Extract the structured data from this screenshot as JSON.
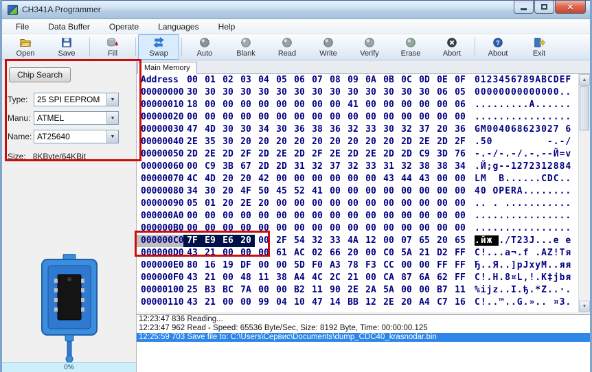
{
  "window": {
    "title": "CH341A Programmer"
  },
  "menu": {
    "items": [
      "File",
      "Data Buffer",
      "Operate",
      "Languages",
      "Help"
    ]
  },
  "toolbar": {
    "buttons": [
      {
        "label": "Open",
        "icon": "open-folder-icon"
      },
      {
        "label": "Save",
        "icon": "save-floppy-icon"
      },
      {
        "label": "Fill",
        "icon": "fill-bucket-icon"
      },
      {
        "label": "Swap",
        "icon": "swap-arrows-icon",
        "active": true
      },
      {
        "label": "Auto",
        "icon": "auto-orb-icon"
      },
      {
        "label": "Blank",
        "icon": "blank-orb-icon"
      },
      {
        "label": "Read",
        "icon": "read-orb-icon"
      },
      {
        "label": "Write",
        "icon": "write-orb-icon"
      },
      {
        "label": "Verify",
        "icon": "verify-orb-icon"
      },
      {
        "label": "Erase",
        "icon": "erase-orb-icon"
      },
      {
        "label": "Abort",
        "icon": "abort-icon"
      },
      {
        "label": "About",
        "icon": "about-icon"
      },
      {
        "label": "Exit",
        "icon": "exit-door-icon"
      }
    ]
  },
  "chip_panel": {
    "search_button": "Chip Search",
    "type_label": "Type:",
    "type_value": "25 SPI EEPROM",
    "manu_label": "Manu:",
    "manu_value": "ATMEL",
    "name_label": "Name:",
    "name_value": "AT25640",
    "size_label": "Size:",
    "size_value": "8KByte/64KBit",
    "progress": "0%"
  },
  "memory": {
    "tab": "Main Memory",
    "header": {
      "address": "Address",
      "bytes": [
        "00",
        "01",
        "02",
        "03",
        "04",
        "05",
        "06",
        "07",
        "08",
        "09",
        "0A",
        "0B",
        "0C",
        "0D",
        "0E",
        "0F"
      ],
      "ascii": "0123456789ABCDEF"
    },
    "selection": {
      "row_address": "000000C0",
      "byte_count": 4,
      "ascii_count": 4
    },
    "rows": [
      {
        "address": "00000000",
        "bytes": [
          "30",
          "30",
          "30",
          "30",
          "30",
          "30",
          "30",
          "30",
          "30",
          "30",
          "30",
          "30",
          "30",
          "30",
          "06",
          "05"
        ],
        "ascii": "00000000000000.."
      },
      {
        "address": "00000010",
        "bytes": [
          "18",
          "00",
          "00",
          "00",
          "00",
          "00",
          "00",
          "00",
          "00",
          "41",
          "00",
          "00",
          "00",
          "00",
          "00",
          "06"
        ],
        "ascii": ".........A......"
      },
      {
        "address": "00000020",
        "bytes": [
          "00",
          "00",
          "00",
          "00",
          "00",
          "00",
          "00",
          "00",
          "00",
          "00",
          "00",
          "00",
          "00",
          "00",
          "00",
          "00"
        ],
        "ascii": "................"
      },
      {
        "address": "00000030",
        "bytes": [
          "47",
          "4D",
          "30",
          "30",
          "34",
          "30",
          "36",
          "38",
          "36",
          "32",
          "33",
          "30",
          "32",
          "37",
          "20",
          "36"
        ],
        "ascii": "GM004068623027 6"
      },
      {
        "address": "00000040",
        "bytes": [
          "2E",
          "35",
          "30",
          "20",
          "20",
          "20",
          "20",
          "20",
          "20",
          "20",
          "20",
          "20",
          "2D",
          "2E",
          "2D",
          "2F"
        ],
        "ascii": ".50         -.-/"
      },
      {
        "address": "00000050",
        "bytes": [
          "2D",
          "2E",
          "2D",
          "2F",
          "2D",
          "2E",
          "2D",
          "2F",
          "2E",
          "2D",
          "2E",
          "2D",
          "2D",
          "C9",
          "3D",
          "76"
        ],
        "ascii": "-.-/-.-/.-.--Й=v"
      },
      {
        "address": "00000060",
        "bytes": [
          "00",
          "C9",
          "3B",
          "67",
          "2D",
          "2D",
          "31",
          "32",
          "37",
          "32",
          "33",
          "31",
          "32",
          "38",
          "38",
          "34"
        ],
        "ascii": ".Й;g--1272312884"
      },
      {
        "address": "00000070",
        "bytes": [
          "4C",
          "4D",
          "20",
          "20",
          "42",
          "00",
          "00",
          "00",
          "00",
          "00",
          "00",
          "43",
          "44",
          "43",
          "00",
          "00"
        ],
        "ascii": "LM  B......CDC.."
      },
      {
        "address": "00000080",
        "bytes": [
          "34",
          "30",
          "20",
          "4F",
          "50",
          "45",
          "52",
          "41",
          "00",
          "00",
          "00",
          "00",
          "00",
          "00",
          "00",
          "00"
        ],
        "ascii": "40 OPERA........"
      },
      {
        "address": "00000090",
        "bytes": [
          "05",
          "01",
          "20",
          "2E",
          "20",
          "00",
          "00",
          "00",
          "00",
          "00",
          "00",
          "00",
          "00",
          "00",
          "00",
          "00"
        ],
        "ascii": ".. . ..........."
      },
      {
        "address": "000000A0",
        "bytes": [
          "00",
          "00",
          "00",
          "00",
          "00",
          "00",
          "00",
          "00",
          "00",
          "00",
          "00",
          "00",
          "00",
          "00",
          "00",
          "00"
        ],
        "ascii": "................"
      },
      {
        "address": "000000B0",
        "bytes": [
          "00",
          "00",
          "00",
          "00",
          "00",
          "00",
          "00",
          "00",
          "00",
          "00",
          "00",
          "00",
          "00",
          "00",
          "00",
          "00"
        ],
        "ascii": "................"
      },
      {
        "address": "000000C0",
        "selected": true,
        "bytes": [
          "7F",
          "E9",
          "E6",
          "20",
          "00",
          "2F",
          "54",
          "32",
          "33",
          "4A",
          "12",
          "00",
          "07",
          "65",
          "20",
          "65"
        ],
        "ascii": ".йж ./T23J...e e"
      },
      {
        "address": "000000D0",
        "bytes": [
          "43",
          "21",
          "00",
          "00",
          "00",
          "61",
          "AC",
          "02",
          "66",
          "20",
          "00",
          "C0",
          "5A",
          "21",
          "D2",
          "FF"
        ],
        "ascii": "C!...a¬.f .АZ!Тя"
      },
      {
        "address": "000000E0",
        "bytes": [
          "80",
          "16",
          "19",
          "DF",
          "00",
          "00",
          "5D",
          "F0",
          "A3",
          "78",
          "F3",
          "CC",
          "00",
          "00",
          "FF",
          "FF"
        ],
        "ascii": "Ђ..Я..]рЈxуМ..яя"
      },
      {
        "address": "000000F0",
        "bytes": [
          "43",
          "21",
          "00",
          "48",
          "11",
          "38",
          "A4",
          "4C",
          "2C",
          "21",
          "00",
          "CA",
          "87",
          "6A",
          "62",
          "FF"
        ],
        "ascii": "C!.H.8¤L,!.К‡jbя"
      },
      {
        "address": "00000100",
        "bytes": [
          "25",
          "B3",
          "BC",
          "7A",
          "00",
          "00",
          "B2",
          "11",
          "90",
          "2E",
          "2A",
          "5A",
          "00",
          "00",
          "B7",
          "11"
        ],
        "ascii": "%іјz..І.ђ.*Z..·."
      },
      {
        "address": "00000110",
        "bytes": [
          "43",
          "21",
          "00",
          "00",
          "99",
          "04",
          "10",
          "47",
          "14",
          "BB",
          "12",
          "2E",
          "20",
          "A4",
          "C7",
          "16"
        ],
        "ascii": "C!..™..G.».. ¤З."
      }
    ]
  },
  "log": {
    "lines": [
      {
        "text": "12:23:47 836 Reading...",
        "selected": false
      },
      {
        "text": "12:23:47 962 Read - Speed: 65536 Byte/Sec, Size: 8192 Byte, Time: 00:00:00.125",
        "selected": false
      },
      {
        "text": "12:25:59 703 Save file to: C:\\Users\\Сервис\\Documents\\dump_CDC40_krasnodar.bin",
        "selected": true
      }
    ]
  },
  "colors": {
    "selection_accent": "#2e86e9",
    "annotation_red": "#cc0b0b",
    "hex_text": "#000084",
    "titlebar_blue": "#b4cde4"
  }
}
